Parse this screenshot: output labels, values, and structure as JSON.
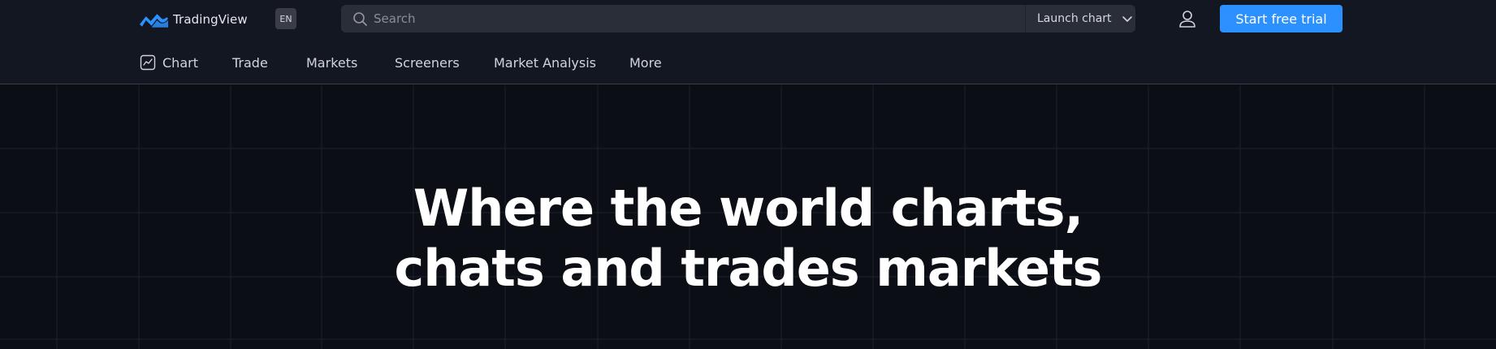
{
  "header": {
    "logo_text": "TradingView",
    "logo_icon": "tradingview-logo-icon",
    "lang": "EN",
    "search": {
      "placeholder": "Search",
      "value": ""
    },
    "launch_chart_label": "Launch chart",
    "user_icon": "user-icon",
    "cta_label": "Start free trial"
  },
  "nav": {
    "items": [
      {
        "label": "Chart",
        "icon": "chart-icon"
      },
      {
        "label": "Trade"
      },
      {
        "label": "Markets"
      },
      {
        "label": "Screeners"
      },
      {
        "label": "Market Analysis"
      },
      {
        "label": "More"
      }
    ]
  },
  "hero": {
    "title_line1": "Where the world charts,",
    "title_line2": "chats and trades markets"
  },
  "colors": {
    "background": "#0c0e15",
    "header_background": "#131722",
    "accent": "#2c91ff",
    "logo_blue": "#2c91ff",
    "text": "#d1d4dc",
    "title": "#ffffff"
  }
}
